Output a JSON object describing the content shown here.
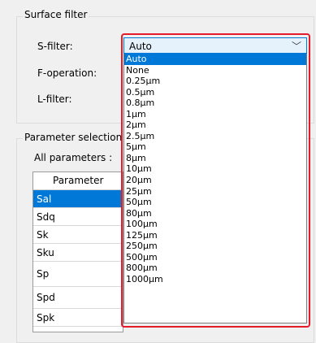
{
  "surface_filter": {
    "title": "Surface filter",
    "s_filter_label": "S-filter:",
    "f_operation_label": "F-operation:",
    "l_filter_label": "L-filter:",
    "s_filter_value": "Auto",
    "options": [
      "Auto",
      "None",
      "0.25μm",
      "0.5μm",
      "0.8μm",
      "1μm",
      "2μm",
      "2.5μm",
      "5μm",
      "8μm",
      "10μm",
      "20μm",
      "25μm",
      "50μm",
      "80μm",
      "100μm",
      "125μm",
      "250μm",
      "500μm",
      "800μm",
      "1000μm"
    ],
    "selected_option": "Auto"
  },
  "parameter_selection": {
    "title": "Parameter selection",
    "all_parameters_label": "All parameters :",
    "column_header": "Parameter",
    "rows": [
      "Sal",
      "Sdq",
      "Sk",
      "Sku",
      "Sp",
      "Spd",
      "Spk"
    ],
    "selected_row": "Sal"
  },
  "colors": {
    "selection": "#0078d7",
    "highlight_border": "#e41b2b"
  }
}
